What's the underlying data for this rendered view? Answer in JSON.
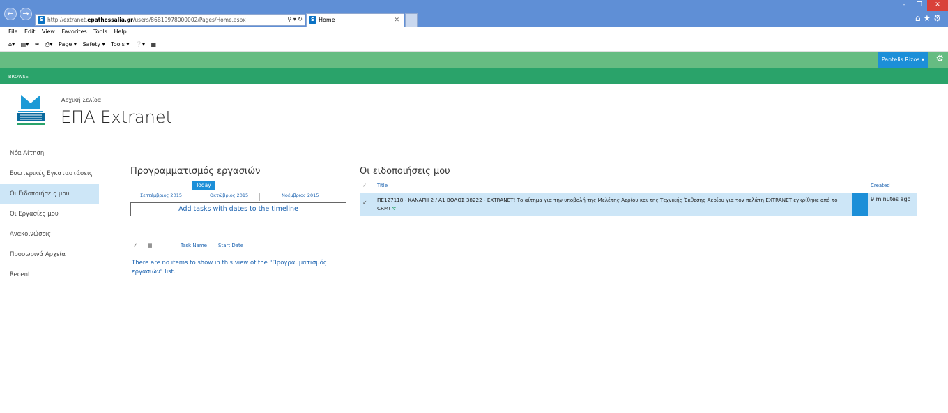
{
  "browser": {
    "url_prefix": "http://extranet.",
    "url_domain": "epathessalia.gr",
    "url_path": "/users/86B19978000002/Pages/Home.aspx",
    "tab_title": "Home",
    "favicon_label": "S",
    "menu": [
      "File",
      "Edit",
      "View",
      "Favorites",
      "Tools",
      "Help"
    ],
    "commands": [
      "Page ▾",
      "Safety ▾",
      "Tools ▾"
    ]
  },
  "suite": {
    "user_name": "Pantelis Rizos ▾",
    "ribbon_tab": "BROWSE"
  },
  "header": {
    "breadcrumb": "Αρχική Σελίδα",
    "site_title": "ΕΠΑ Extranet"
  },
  "leftnav": {
    "items": [
      {
        "label": "Νέα Αίτηση"
      },
      {
        "label": "Εσωτερικές Εγκαταστάσεις"
      },
      {
        "label": "Οι Ειδοποιήσεις μου"
      },
      {
        "label": "Οι Εργασίες μου"
      },
      {
        "label": "Ανακοινώσεις"
      },
      {
        "label": "Προσωρινά Αρχεία"
      },
      {
        "label": "Recent"
      }
    ],
    "active_index": 2
  },
  "tasks": {
    "title": "Προγραμματισμός εργασιών",
    "today_label": "Today",
    "months": [
      "Σεπτέμβριος 2015",
      "Οκτώβριος 2015",
      "Νοέμβριος 2015"
    ],
    "timeline_placeholder": "Add tasks with dates to the timeline",
    "col_task_name": "Task Name",
    "col_start_date": "Start Date",
    "empty_message": "There are no items to show in this view of the \"Προγραμματισμός εργασιών\" list."
  },
  "notifications": {
    "title": "Οι ειδοποιήσεις μου",
    "col_title": "Title",
    "col_created": "Created",
    "rows": [
      {
        "title": "ΠΕ127118 - ΚΑΝΑΡΗ 2 / Α1 ΒΟΛΟΣ 38222 - EXTRANET! Το αίτημα για την υποβολή της Μελέτης Αερίου και της Τεχνικής Έκθεσης Αερίου για τον πελάτη EXTRANET εγκρίθηκε από το CRM!",
        "new_marker": "✲",
        "created": "9 minutes ago"
      }
    ]
  },
  "colors": {
    "suite_bar": "#66bc82",
    "ribbon": "#2aa36a",
    "accent": "#1c8fd8",
    "selected_row": "#cde6f7"
  }
}
